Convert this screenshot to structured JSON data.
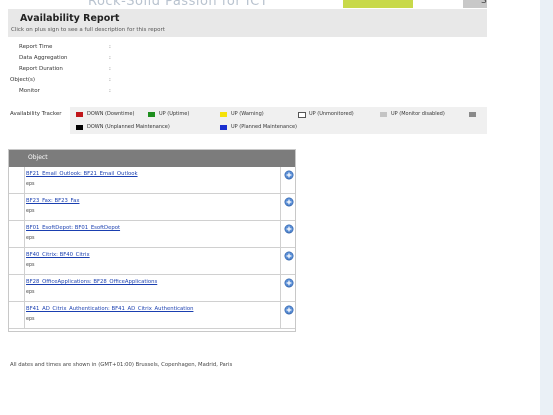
{
  "banner": {
    "text": "Rock-Solid Passion for ICT",
    "right_fragment": "Sp"
  },
  "header": {
    "title": "Availability Report",
    "subtitle": "Click on plus sign to see a full description for this report"
  },
  "meta": [
    {
      "label": "Report Time",
      "sep": ":"
    },
    {
      "label": "Data Aggregation",
      "sep": ":"
    },
    {
      "label": "Report Duration",
      "sep": ":"
    },
    {
      "label": "Object(s)",
      "sep": ":"
    },
    {
      "label": "Monitor",
      "sep": ":"
    }
  ],
  "availability": {
    "label": "Availability Tracker",
    "legend": [
      {
        "text": "DOWN (Downtime)",
        "color": "#c0161a"
      },
      {
        "text": "UP (Uptime)",
        "color": "#1e8f1e"
      },
      {
        "text": "UP (Warning)",
        "color": "#f5e20a"
      },
      {
        "text": "UP (Unmonitored)",
        "color": "#ffffff"
      },
      {
        "text": "UP (Monitor disabled)",
        "color": "#c4c4c4"
      },
      {
        "text": "DOWN (Unplanned Maintenance)",
        "color": "#000000"
      },
      {
        "text": "UP (Planned Maintenance)",
        "color": "#1a2fd0"
      }
    ],
    "extra_swatch_color": "#8a8a8a"
  },
  "table": {
    "header": "Object",
    "rows": [
      {
        "link": "BF21_Email_Outlook: BF21_Email_Outlook",
        "sub": "eps"
      },
      {
        "link": "BF23_Fax: BF23_Fax",
        "sub": "eps"
      },
      {
        "link": "BF01_EsoftDepot: BF01_EsoftDepot",
        "sub": "eps"
      },
      {
        "link": "BF40_Citrix: BF40_Citrix",
        "sub": "eps"
      },
      {
        "link": "BF28_OfficeApplications: BF28_OfficeApplications",
        "sub": "eps"
      },
      {
        "link": "BF41_AD_Citrix_Authentication: BF41_AD_Citrix_Authentication",
        "sub": "eps"
      }
    ]
  },
  "footer": "All dates and times are shown in (GMT+01:00) Brussels, Copenhagen, Madrid, Paris"
}
